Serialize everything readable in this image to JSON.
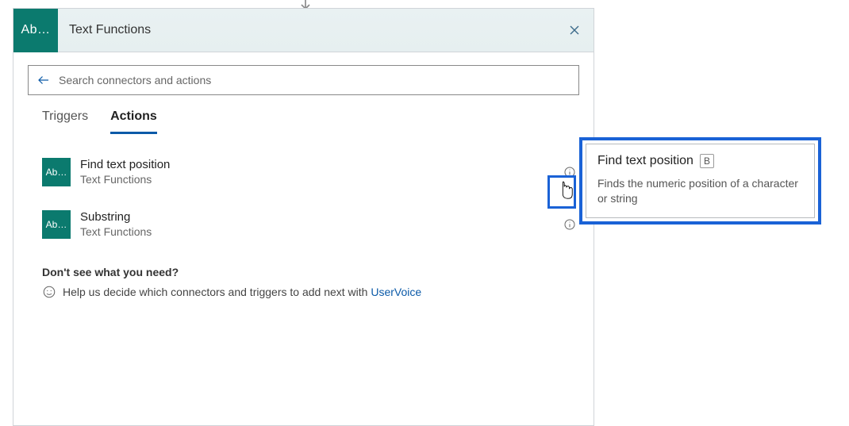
{
  "header": {
    "iconText": "Ab…",
    "title": "Text Functions"
  },
  "search": {
    "placeholder": "Search connectors and actions"
  },
  "tabs": {
    "triggers": "Triggers",
    "actions": "Actions"
  },
  "actions": [
    {
      "iconText": "Ab…",
      "title": "Find text position",
      "subtitle": "Text Functions"
    },
    {
      "iconText": "Ab…",
      "title": "Substring",
      "subtitle": "Text Functions"
    }
  ],
  "footer": {
    "heading": "Don't see what you need?",
    "text": "Help us decide which connectors and triggers to add next with ",
    "link": "UserVoice"
  },
  "tooltip": {
    "title": "Find text position",
    "badge": "B",
    "description": "Finds the numeric position of a character or string"
  }
}
